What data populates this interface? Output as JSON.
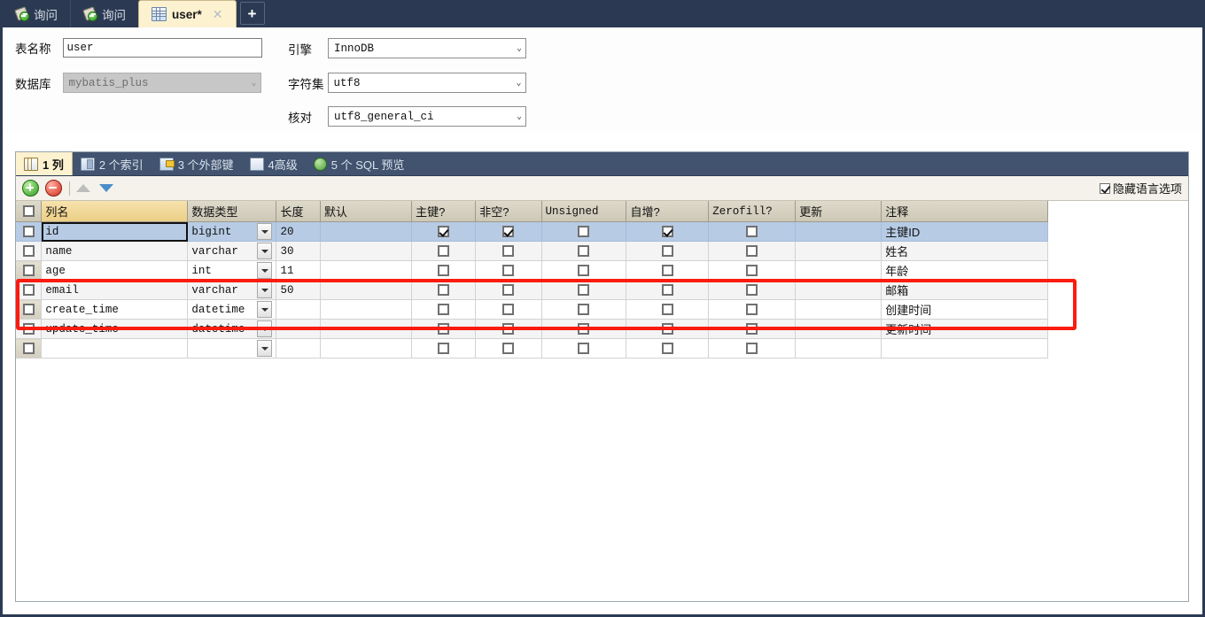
{
  "window": {
    "accent": "#2b3a52",
    "highlight_color": "#fb1b10"
  },
  "tabs": [
    {
      "label": "询问",
      "icon": "query-icon",
      "active": false
    },
    {
      "label": "询问",
      "icon": "query-icon",
      "active": false
    },
    {
      "label": "user*",
      "icon": "table-icon",
      "active": true,
      "close": "✕"
    }
  ],
  "add_tab_label": "+",
  "form": {
    "table_name_label": "表名称",
    "table_name_value": "user",
    "database_label": "数据库",
    "database_value": "mybatis_plus",
    "engine_label": "引擎",
    "engine_value": "InnoDB",
    "charset_label": "字符集",
    "charset_value": "utf8",
    "collation_label": "核对",
    "collation_value": "utf8_general_ci"
  },
  "subtabs": [
    {
      "label": "1 列",
      "icon": "columns-icon",
      "active": true
    },
    {
      "label": "2 个索引",
      "icon": "index-icon",
      "active": false
    },
    {
      "label": "3 个外部键",
      "icon": "foreign-key-icon",
      "active": false
    },
    {
      "label": "4高级",
      "icon": "advanced-icon",
      "active": false
    },
    {
      "label": "5 个 SQL 预览",
      "icon": "sql-preview-icon",
      "active": false
    }
  ],
  "toolbar": {
    "add_title": "添加栏位",
    "delete_title": "删除栏位",
    "move_up_title": "上移",
    "move_down_title": "下移",
    "hide_lang_label": "隐藏语言选项",
    "hide_lang_checked": true
  },
  "grid": {
    "headers": [
      "列名",
      "数据类型",
      "长度",
      "默认",
      "主键?",
      "非空?",
      "Unsigned",
      "自增?",
      "Zerofill?",
      "更新",
      "注释"
    ],
    "rows": [
      {
        "name": "id",
        "type": "bigint",
        "length": "20",
        "default": "",
        "pk": true,
        "notnull": true,
        "unsigned": false,
        "autoinc": true,
        "zerofill": false,
        "update": "",
        "comment": "主键ID",
        "selected": true
      },
      {
        "name": "name",
        "type": "varchar",
        "length": "30",
        "default": "",
        "pk": false,
        "notnull": false,
        "unsigned": false,
        "autoinc": false,
        "zerofill": false,
        "update": "",
        "comment": "姓名",
        "selected": false
      },
      {
        "name": "age",
        "type": "int",
        "length": "11",
        "default": "",
        "pk": false,
        "notnull": false,
        "unsigned": false,
        "autoinc": false,
        "zerofill": false,
        "update": "",
        "comment": "年龄",
        "selected": false
      },
      {
        "name": "email",
        "type": "varchar",
        "length": "50",
        "default": "",
        "pk": false,
        "notnull": false,
        "unsigned": false,
        "autoinc": false,
        "zerofill": false,
        "update": "",
        "comment": "邮箱",
        "selected": false
      },
      {
        "name": "create_time",
        "type": "datetime",
        "length": "",
        "default": "",
        "pk": false,
        "notnull": false,
        "unsigned": false,
        "autoinc": false,
        "zerofill": false,
        "update": "",
        "comment": "创建时间",
        "selected": false
      },
      {
        "name": "update_time",
        "type": "datetime",
        "length": "",
        "default": "",
        "pk": false,
        "notnull": false,
        "unsigned": false,
        "autoinc": false,
        "zerofill": false,
        "update": "",
        "comment": "更新时间",
        "selected": false
      },
      {
        "name": "",
        "type": "",
        "length": "",
        "default": "",
        "pk": false,
        "notnull": false,
        "unsigned": false,
        "autoinc": false,
        "zerofill": false,
        "update": "",
        "comment": "",
        "selected": false
      }
    ]
  }
}
